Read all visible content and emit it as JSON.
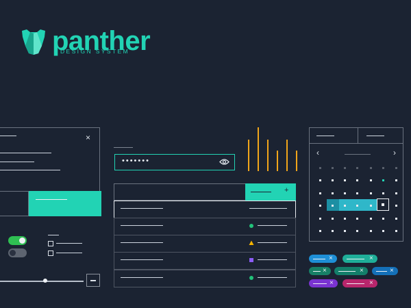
{
  "brand": {
    "name": "panther",
    "tagline": "DESIGN SYSTEM",
    "accent": "#22d3b4"
  },
  "modal": {
    "close_icon": "×",
    "close_icon_name": "close-icon"
  },
  "password": {
    "masked_value": "•••••••",
    "eye_icon": "eye-icon"
  },
  "table": {
    "add_icon": "+",
    "row_status_colors": [
      "none",
      "#22c27a",
      "#f5b300",
      "#8b5cf6",
      "#22c27a"
    ],
    "row_status_icons": [
      "none",
      "circle",
      "triangle",
      "square",
      "circle"
    ]
  },
  "toggles": {
    "colors": {
      "on": "#2fbf52",
      "off": "#5d6470"
    },
    "states": [
      "on",
      "off"
    ]
  },
  "slider": {
    "value_fraction": 0.52,
    "minus_icon": "—"
  },
  "calendar": {
    "prev_icon": "‹",
    "next_icon": "›",
    "range_color": "#2fb7c9"
  },
  "tags": {
    "close_icon": "×",
    "colors": [
      "#1e8fd6",
      "#1fae99",
      "#178066",
      "#137f6a",
      "#1470b8",
      "#7a33d1",
      "#b8266c"
    ]
  }
}
